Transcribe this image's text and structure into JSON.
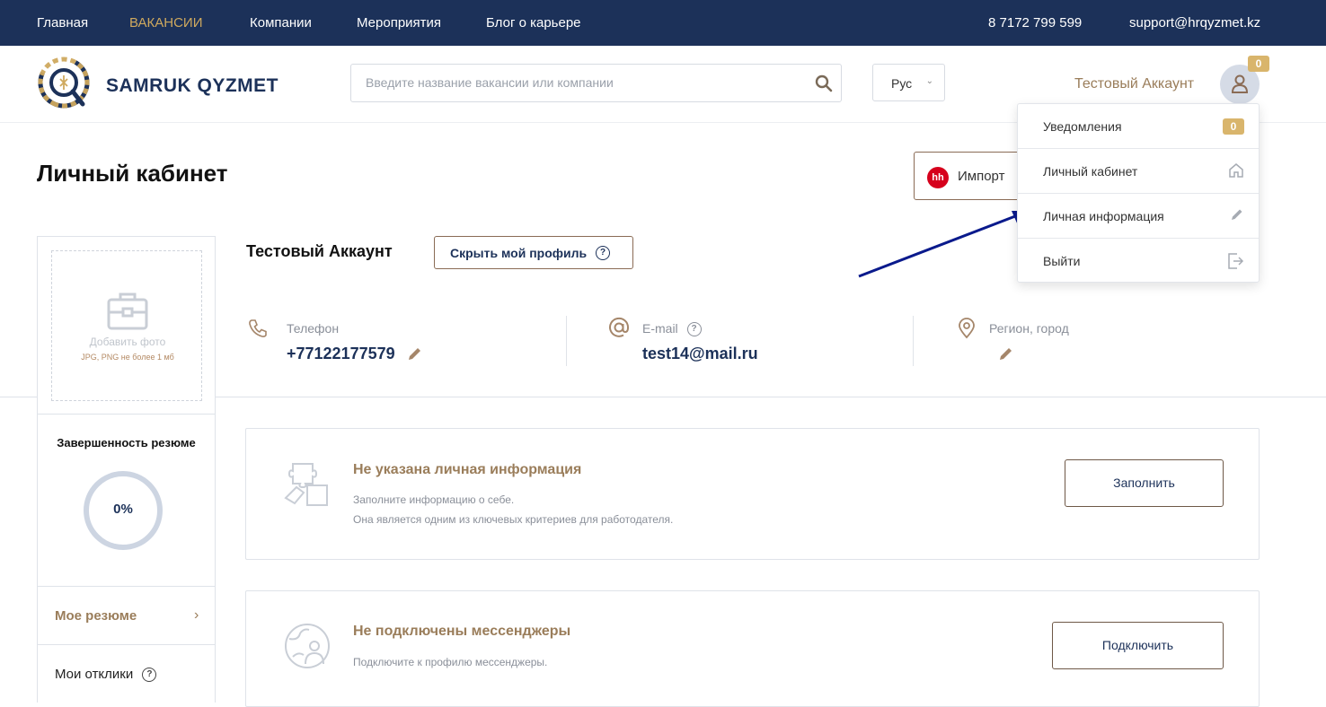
{
  "topnav": {
    "items": [
      {
        "label": "Главная"
      },
      {
        "label": "ВАКАНСИИ"
      },
      {
        "label": "Компании"
      },
      {
        "label": "Мероприятия"
      },
      {
        "label": "Блог о карьере"
      }
    ],
    "phone": "8 7172 799 599",
    "email": "support@hrqyzmet.kz"
  },
  "header": {
    "logo_text": "SAMRUK QYZMET",
    "search_placeholder": "Введите название вакансии или компании",
    "language": "Рус",
    "account_name": "Тестовый Аккаунт",
    "notification_count": "0"
  },
  "dropdown": {
    "items": [
      {
        "label": "Уведомления",
        "badge": "0"
      },
      {
        "label": "Личный кабинет",
        "icon": "home-icon"
      },
      {
        "label": "Личная информация",
        "icon": "pencil-icon"
      },
      {
        "label": "Выйти",
        "icon": "logout-icon"
      }
    ]
  },
  "page": {
    "title": "Личный кабинет",
    "import_label": "Импорт",
    "import_logo": "hh"
  },
  "sidebar": {
    "photo_add": "Добавить фото",
    "photo_hint": "JPG, PNG не более 1 мб",
    "completeness_label": "Завершенность резюме",
    "completeness_value": "0%",
    "completeness_fraction": 0,
    "my_resume": "Мое резюме",
    "my_responses": "Мои отклики"
  },
  "profile": {
    "name": "Тестовый Аккаунт",
    "hide_button": "Скрыть мой профиль",
    "phone_label": "Телефон",
    "phone_value": "+77122177579",
    "email_label": "E-mail",
    "email_value": "test14@mail.ru",
    "region_label": "Регион, город"
  },
  "cards": [
    {
      "title": "Не указана личная информация",
      "text1": "Заполните информацию о себе.",
      "text2": "Она является одним из ключевых критериев для работодателя.",
      "button": "Заполнить"
    },
    {
      "title": "Не подключены мессенджеры",
      "text1": "Подключите к профилю мессенджеры.",
      "button": "Подключить"
    }
  ],
  "colors": {
    "navy": "#1c3159",
    "gold": "#cfa95e",
    "brown": "#9a7d5a",
    "annotation_arrow": "#0a1a8c"
  }
}
